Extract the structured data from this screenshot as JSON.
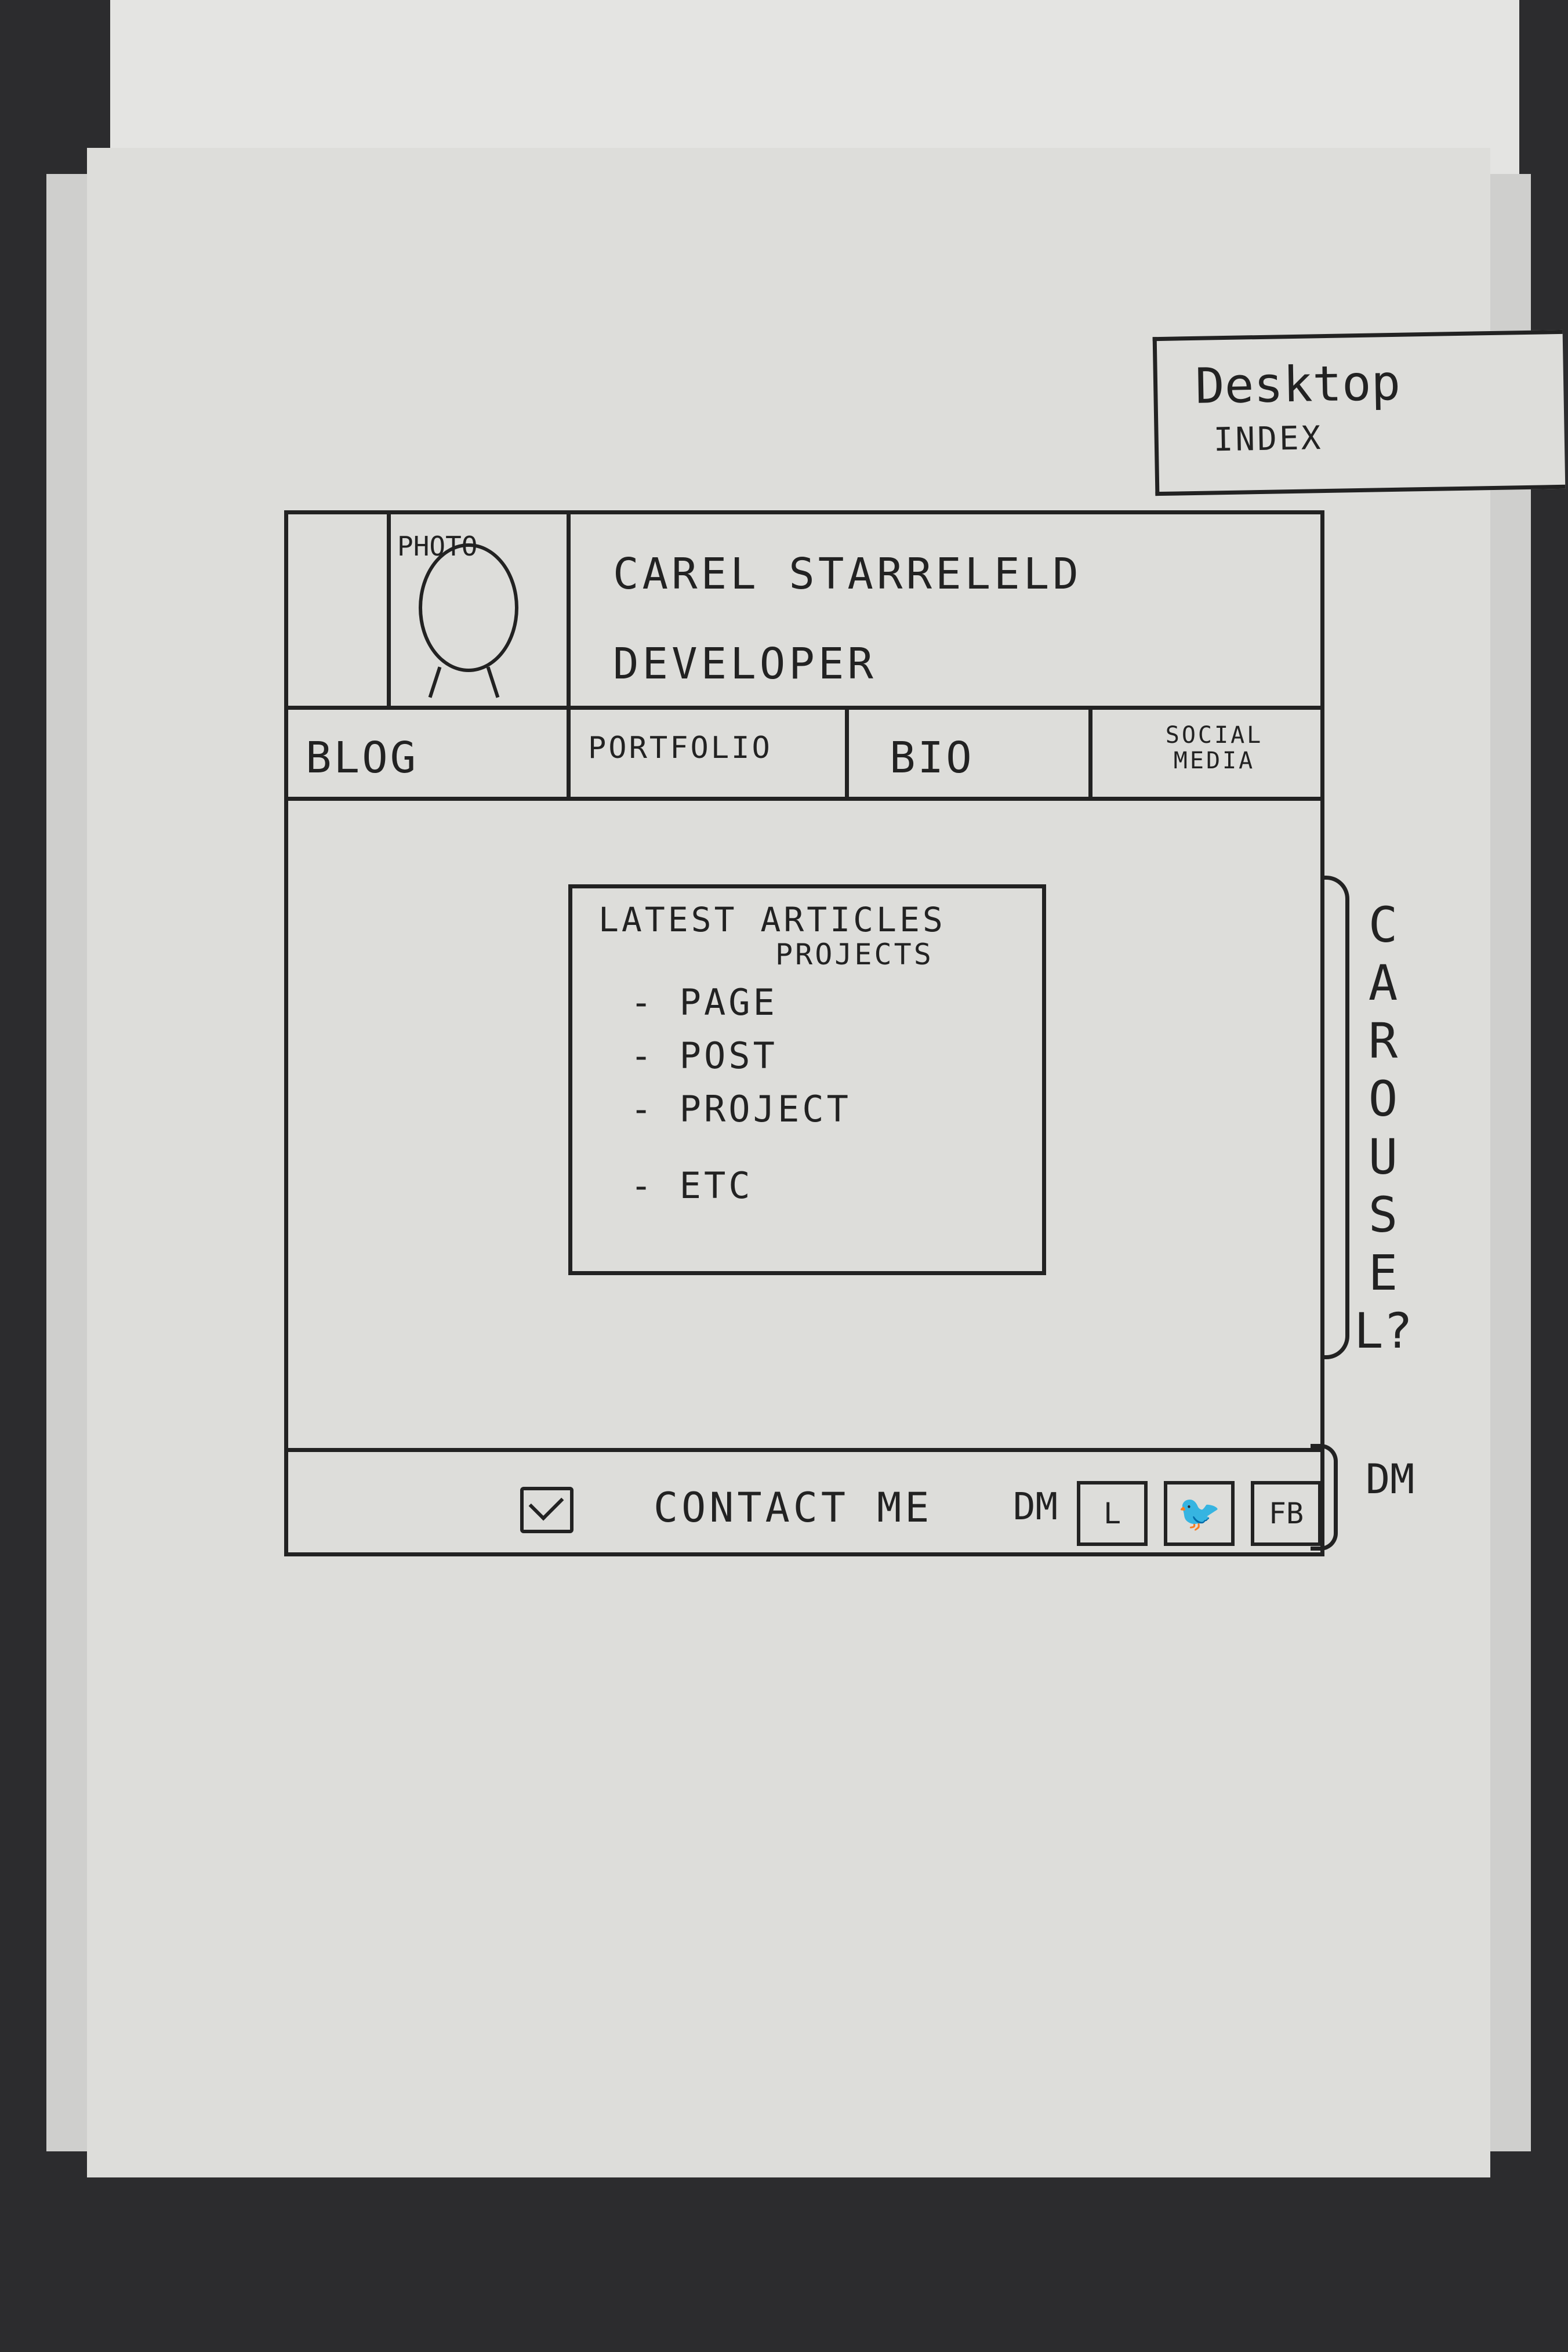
{
  "tab": {
    "line1": "Desktop",
    "line2": "INDEX"
  },
  "header": {
    "photo_label": "PHOTO",
    "name": "CAREL STARRELELD",
    "role": "DEVELOPER"
  },
  "nav": {
    "items": [
      {
        "label": "BLOG"
      },
      {
        "label": "PORTFOLIO"
      },
      {
        "label": "BIO"
      },
      {
        "label": "SOCIAL MEDIA"
      }
    ]
  },
  "content": {
    "title": "LATEST ARTICLES",
    "subtitle": "PROJECTS",
    "items": [
      "- PAGE",
      "- POST",
      "- PROJECT",
      "- ETC"
    ]
  },
  "footer": {
    "contact_label": "CONTACT ME",
    "dm_label": "DM",
    "linkedin_label": "L",
    "twitter_label": "🐦",
    "facebook_label": "FB"
  },
  "annotations": {
    "carousel": "CAROUSEL?",
    "dm": "DM"
  },
  "icons": {
    "mail": "envelope-icon",
    "linkedin": "linkedin-icon",
    "twitter": "twitter-icon",
    "facebook": "facebook-icon",
    "photo": "avatar-icon"
  }
}
